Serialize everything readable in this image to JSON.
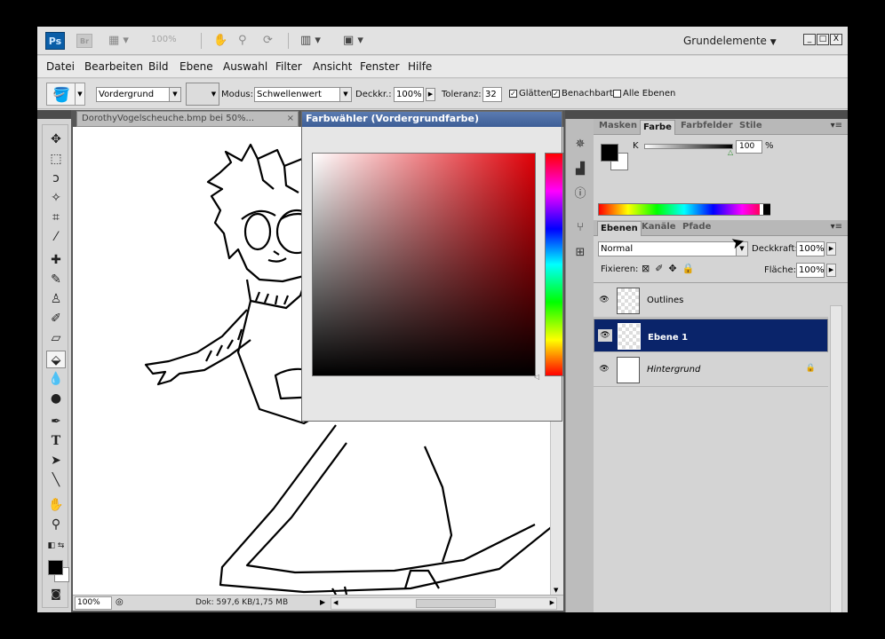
{
  "appbar": {
    "logo": "Ps",
    "bridge": "Br",
    "zoom": "100%",
    "workspace": "Grundelemente",
    "window_buttons": [
      "_",
      "□",
      "X"
    ]
  },
  "menu": [
    "Datei",
    "Bearbeiten",
    "Bild",
    "Ebene",
    "Auswahl",
    "Filter",
    "Ansicht",
    "Fenster",
    "Hilfe"
  ],
  "options": {
    "fill_source": "Vordergrund",
    "mode_label": "Modus:",
    "mode_value": "Schwellenwert",
    "opacity_label": "Deckkr.:",
    "opacity_value": "100%",
    "tolerance_label": "Toleranz:",
    "tolerance_value": "32",
    "antialias_label": "Glätten",
    "contiguous_label": "Benachbart",
    "all_layers_label": "Alle Ebenen"
  },
  "document": {
    "tab_title": "DorothyVogelscheuche.bmp bei 50%...",
    "tab_close": "×",
    "status_zoom": "100%",
    "status_doc": "Dok: 597,6 KB/1,75 MB"
  },
  "color_picker": {
    "title": "Farbwähler (Vordergrundfarbe)"
  },
  "color_panel": {
    "tabs": [
      "Masken",
      "Farbe",
      "Farbfelder",
      "Stile"
    ],
    "active_tab": "Farbe",
    "channel_label": "K",
    "channel_value": "100",
    "unit": "%"
  },
  "layers_panel": {
    "tabs": [
      "Ebenen",
      "Kanäle",
      "Pfade"
    ],
    "blend_mode": "Normal",
    "opacity_label": "Deckkraft:",
    "opacity_value": "100%",
    "lock_label": "Fixieren:",
    "fill_label": "Fläche:",
    "fill_value": "100%",
    "layers": [
      {
        "name": "Outlines",
        "selected": false,
        "locked": false
      },
      {
        "name": "Ebene 1",
        "selected": true,
        "locked": false
      },
      {
        "name": "Hintergrund",
        "selected": false,
        "locked": true
      }
    ]
  },
  "colors": {
    "selection": "#0a246a",
    "picker_hue": "#e00008"
  }
}
